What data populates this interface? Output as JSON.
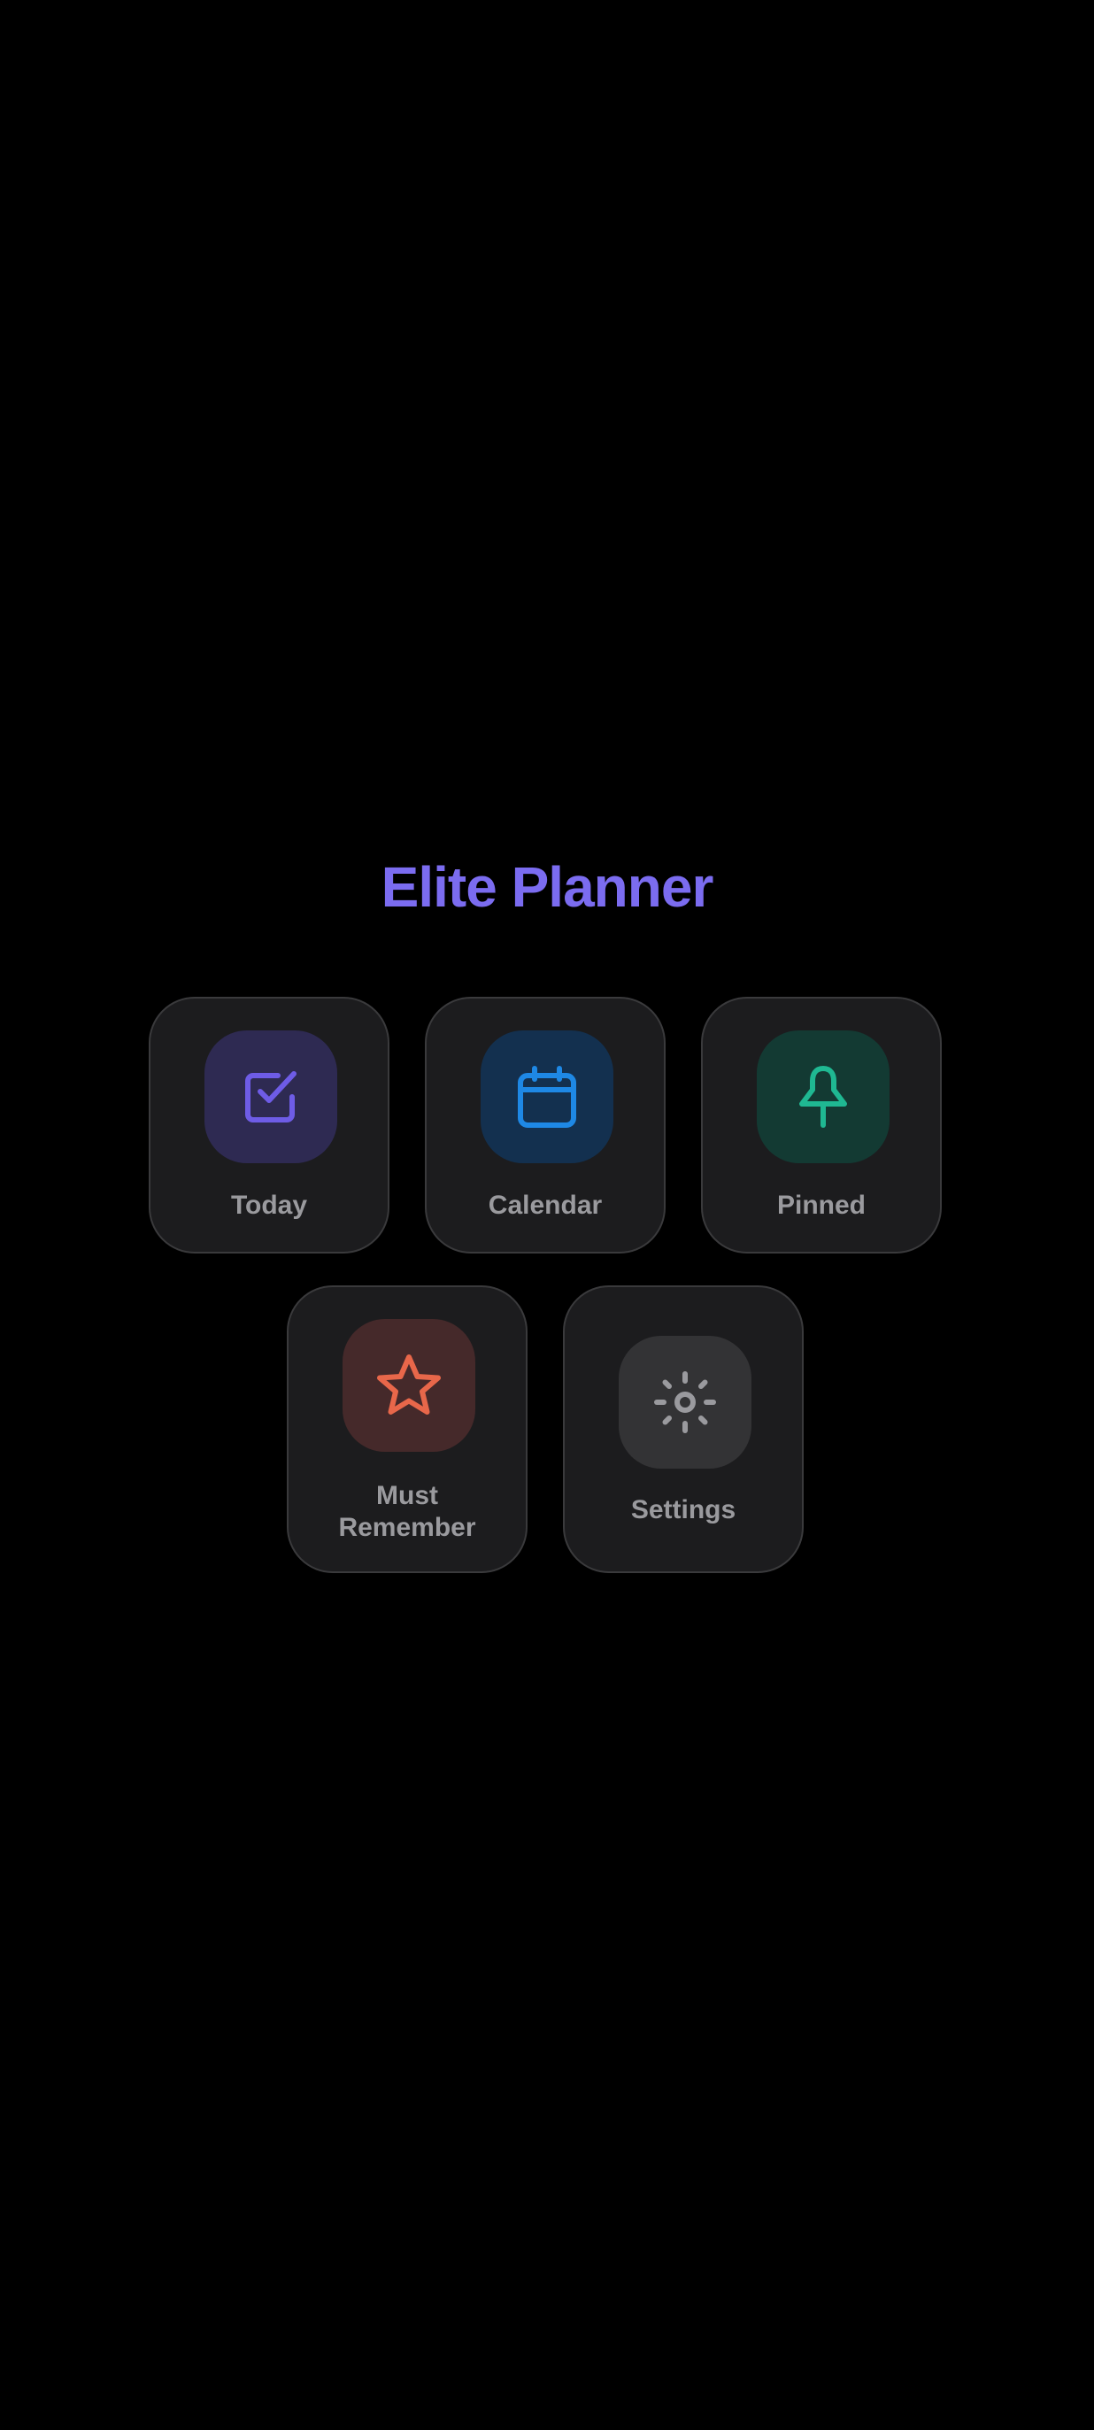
{
  "app": {
    "title": "Elite Planner",
    "accent_color": "#7b6cf0"
  },
  "tiles": [
    {
      "id": "today",
      "label": "Today",
      "icon": "checkbox-checked-icon",
      "icon_color": "#6e5ce6",
      "icon_bg": "#2e2a52"
    },
    {
      "id": "calendar",
      "label": "Calendar",
      "icon": "calendar-icon",
      "icon_color": "#1e88e5",
      "icon_bg": "#13304f"
    },
    {
      "id": "pinned",
      "label": "Pinned",
      "icon": "pin-icon",
      "icon_color": "#1fb892",
      "icon_bg": "#133a33"
    },
    {
      "id": "must_remember",
      "label_line1": "Must",
      "label_line2": "Remember",
      "icon": "star-icon",
      "icon_color": "#e8674a",
      "icon_bg": "#45292a"
    },
    {
      "id": "settings",
      "label": "Settings",
      "icon": "sun-gear-icon",
      "icon_color": "#9a9a9e",
      "icon_bg": "#333335"
    }
  ]
}
